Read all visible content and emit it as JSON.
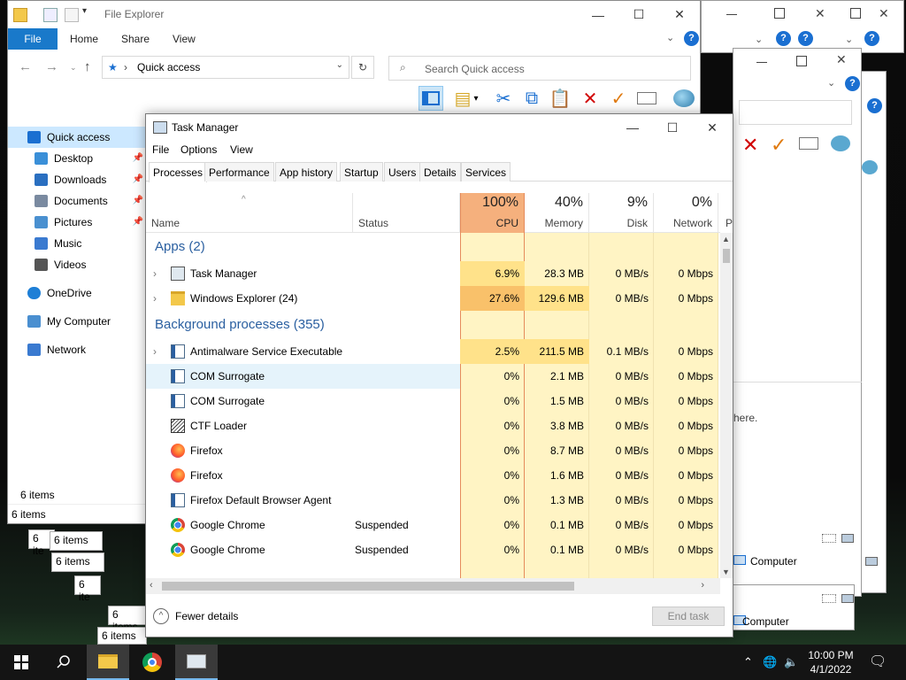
{
  "colors": {
    "accent": "#1979ca",
    "cpu_header": "#f5b07d",
    "heat_light": "#fff4c4",
    "heat_mid": "#ffe28a",
    "heat_high": "#f9c16a",
    "group": "#2a5fa0"
  },
  "explorer": {
    "title": "File Explorer",
    "ribbon_tabs": [
      "File",
      "Home",
      "Share",
      "View"
    ],
    "address": "Quick access",
    "search_placeholder": "Search Quick access",
    "nav_items": [
      {
        "label": "Quick access",
        "icon": "star-icon",
        "pinned": false
      },
      {
        "label": "Desktop",
        "icon": "desktop-icon",
        "pinned": true
      },
      {
        "label": "Downloads",
        "icon": "download-icon",
        "pinned": true
      },
      {
        "label": "Documents",
        "icon": "documents-icon",
        "pinned": true
      },
      {
        "label": "Pictures",
        "icon": "pictures-icon",
        "pinned": true
      },
      {
        "label": "Music",
        "icon": "music-icon",
        "pinned": false
      },
      {
        "label": "Videos",
        "icon": "videos-icon",
        "pinned": false
      },
      {
        "label": "OneDrive",
        "icon": "cloud-icon",
        "pinned": false
      },
      {
        "label": "My Computer",
        "icon": "computer-icon",
        "pinned": false
      },
      {
        "label": "Network",
        "icon": "network-icon",
        "pinned": false
      }
    ],
    "status_items": "6 items",
    "status_bottom": "6 items"
  },
  "background_snippets": {
    "items": [
      "6 items",
      "6 items",
      "6 items",
      "6 items",
      "6 items",
      "6 items",
      "6 ite",
      "6 ite"
    ],
    "computer_a": "Computer",
    "computer_b": "Computer",
    "here_text": "here."
  },
  "taskmanager": {
    "title": "Task Manager",
    "menu": [
      "File",
      "Options",
      "View"
    ],
    "tabs": [
      "Processes",
      "Performance",
      "App history",
      "Startup",
      "Users",
      "Details",
      "Services"
    ],
    "columns": {
      "name": "Name",
      "status": "Status",
      "cpu": {
        "pct": "100%",
        "label": "CPU"
      },
      "memory": {
        "pct": "40%",
        "label": "Memory"
      },
      "disk": {
        "pct": "9%",
        "label": "Disk"
      },
      "network": {
        "pct": "0%",
        "label": "Network"
      },
      "extra": "P"
    },
    "groups": {
      "apps": "Apps (2)",
      "background": "Background processes (355)"
    },
    "apps": [
      {
        "name": "Task Manager",
        "status": "",
        "cpu": "6.9%",
        "memory": "28.3 MB",
        "disk": "0 MB/s",
        "network": "0 Mbps",
        "icon": "task-manager-icon",
        "expandable": true
      },
      {
        "name": "Windows Explorer (24)",
        "status": "",
        "cpu": "27.6%",
        "memory": "129.6 MB",
        "disk": "0 MB/s",
        "network": "0 Mbps",
        "icon": "folder-icon",
        "expandable": true
      }
    ],
    "background": [
      {
        "name": "Antimalware Service Executable",
        "status": "",
        "cpu": "2.5%",
        "memory": "211.5 MB",
        "disk": "0.1 MB/s",
        "network": "0 Mbps",
        "icon": "service-icon",
        "expandable": true
      },
      {
        "name": "COM Surrogate",
        "status": "",
        "cpu": "0%",
        "memory": "2.1 MB",
        "disk": "0 MB/s",
        "network": "0 Mbps",
        "icon": "service-icon",
        "expandable": false
      },
      {
        "name": "COM Surrogate",
        "status": "",
        "cpu": "0%",
        "memory": "1.5 MB",
        "disk": "0 MB/s",
        "network": "0 Mbps",
        "icon": "service-icon",
        "expandable": false
      },
      {
        "name": "CTF Loader",
        "status": "",
        "cpu": "0%",
        "memory": "3.8 MB",
        "disk": "0 MB/s",
        "network": "0 Mbps",
        "icon": "ctf-icon",
        "expandable": false
      },
      {
        "name": "Firefox",
        "status": "",
        "cpu": "0%",
        "memory": "8.7 MB",
        "disk": "0 MB/s",
        "network": "0 Mbps",
        "icon": "firefox-icon",
        "expandable": false
      },
      {
        "name": "Firefox",
        "status": "",
        "cpu": "0%",
        "memory": "1.6 MB",
        "disk": "0 MB/s",
        "network": "0 Mbps",
        "icon": "firefox-icon",
        "expandable": false
      },
      {
        "name": "Firefox Default Browser Agent",
        "status": "",
        "cpu": "0%",
        "memory": "1.3 MB",
        "disk": "0 MB/s",
        "network": "0 Mbps",
        "icon": "service-icon",
        "expandable": false
      },
      {
        "name": "Google Chrome",
        "status": "Suspended",
        "cpu": "0%",
        "memory": "0.1 MB",
        "disk": "0 MB/s",
        "network": "0 Mbps",
        "icon": "chrome-icon",
        "expandable": false
      },
      {
        "name": "Google Chrome",
        "status": "Suspended",
        "cpu": "0%",
        "memory": "0.1 MB",
        "disk": "0 MB/s",
        "network": "0 Mbps",
        "icon": "chrome-icon",
        "expandable": false
      }
    ],
    "fewer_details": "Fewer details",
    "end_task": "End task"
  },
  "taskbar": {
    "clock_time": "10:00 PM",
    "clock_date": "4/1/2022"
  }
}
